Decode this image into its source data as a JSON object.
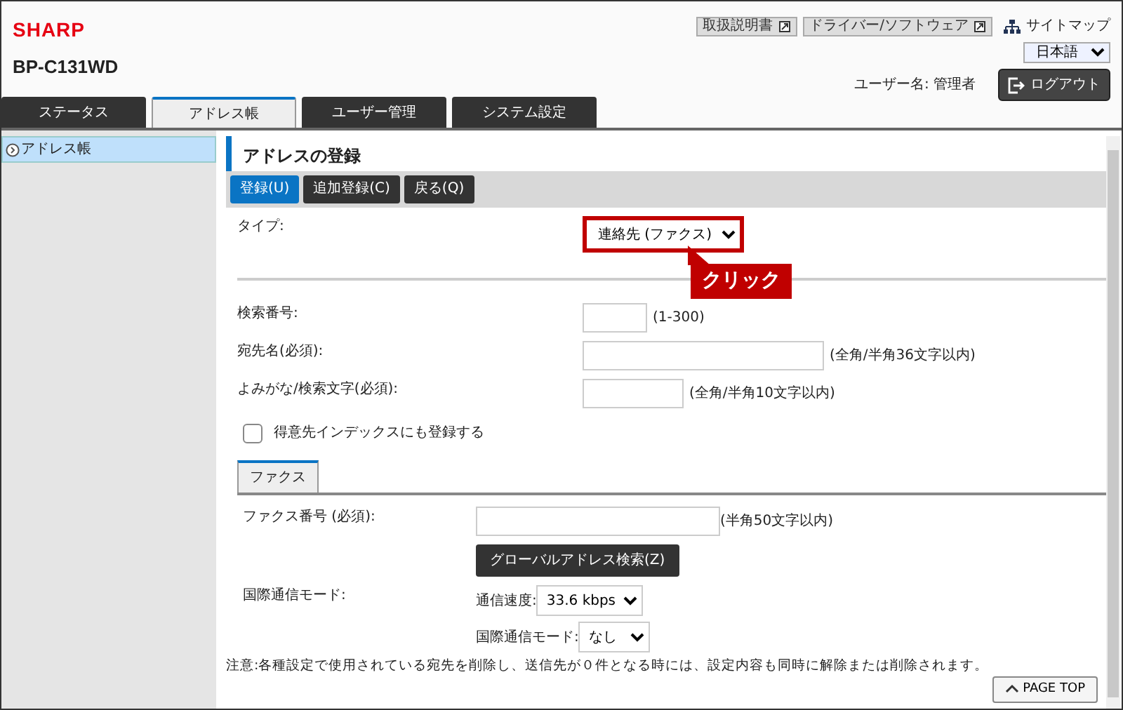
{
  "header": {
    "logo": "SHARP",
    "model": "BP-C131WD",
    "links": [
      {
        "label": "取扱説明書"
      },
      {
        "label": "ドライバー/ソフトウェア"
      }
    ],
    "sitemap": "サイトマップ",
    "language": "日本語",
    "user_label": "ユーザー名: 管理者",
    "logout": "ログアウト"
  },
  "tabs": [
    {
      "label": "ステータス",
      "selected": false
    },
    {
      "label": "アドレス帳",
      "selected": true
    },
    {
      "label": "ユーザー管理",
      "selected": false
    },
    {
      "label": "システム設定",
      "selected": false
    }
  ],
  "sidebar": {
    "items": [
      {
        "label": "アドレス帳",
        "selected": true
      }
    ]
  },
  "page_title": "アドレスの登録",
  "toolbar": [
    {
      "label": "登録(U)",
      "kind": "primary"
    },
    {
      "label": "追加登録(C)",
      "kind": "secondary"
    },
    {
      "label": "戻る(Q)",
      "kind": "secondary"
    }
  ],
  "type_field": {
    "label": "タイプ:",
    "value": "連絡先 (ファクス)"
  },
  "callout": "クリック",
  "fields": [
    {
      "label": "検索番号:",
      "hint": "(1-300)"
    },
    {
      "label": "宛先名(必須):",
      "hint": "(全角/半角36文字以内)"
    },
    {
      "label": "よみがな/検索文字(必須):",
      "hint": "(全角/半角10文字以内)"
    }
  ],
  "index_checkbox": {
    "label": "得意先インデックスにも登録する",
    "checked": false
  },
  "sub_tabs": [
    {
      "label": "ファクス",
      "selected": true
    }
  ],
  "fax_number": {
    "label": "ファクス番号 (必須):",
    "hint": "(半角50文字以内)"
  },
  "global_search_button": "グローバルアドレス検索(Z)",
  "intl_mode": {
    "label": "国際通信モード:",
    "speed_label": "通信速度:",
    "speed": "33.6 kbps",
    "mode_label": "国際通信モード:",
    "mode": "なし"
  },
  "note": "注意:各種設定で使用されている宛先を削除し、送信先が０件となる時には、設定内容も同時に解除または削除されます。",
  "page_top": "PAGE TOP"
}
